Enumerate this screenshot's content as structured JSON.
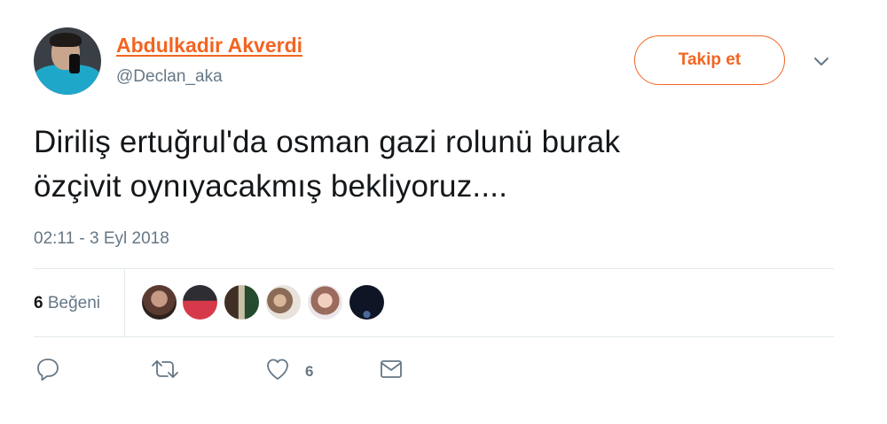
{
  "author": {
    "display_name": "Abdulkadir Akverdi",
    "handle": "@Declan_aka"
  },
  "follow_button": {
    "label": "Takip et"
  },
  "tweet": {
    "text_line1": "Diriliş ertuğrul'da osman gazi rolunü burak",
    "text_line2": "özçivit oynıyacakmış bekliyoruz....",
    "timestamp": "02:11 - 3 Eyl 2018"
  },
  "stats": {
    "likes_number": "6",
    "likes_label": "Beğeni"
  },
  "actions": {
    "like_count": "6"
  },
  "icons": [
    "chevron-down-icon",
    "reply-icon",
    "retweet-icon",
    "heart-icon",
    "message-icon"
  ],
  "colors": {
    "accent": "#f26522",
    "secondary_text": "#657786",
    "divider": "#e1e8ed",
    "primary_text": "#14171a"
  }
}
